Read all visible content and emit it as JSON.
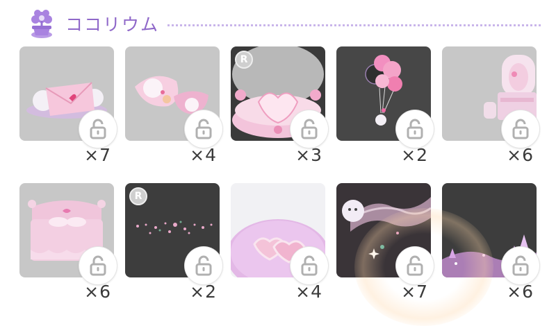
{
  "header": {
    "title": "ココリウム",
    "icon": "kokorium-plant-icon"
  },
  "items": [
    {
      "name": "envelope-ghosts",
      "count": "×7",
      "badge": "",
      "locked": true,
      "bg": "#c7c7c7"
    },
    {
      "name": "ghost-pillows",
      "count": "×4",
      "badge": "",
      "locked": true,
      "bg": "#c7c7c7"
    },
    {
      "name": "heart-cake-stage",
      "count": "×3",
      "badge": "R",
      "locked": true,
      "bg": "#3a3a3a"
    },
    {
      "name": "balloon-ghost",
      "count": "×2",
      "badge": "",
      "locked": true,
      "bg": "#474747"
    },
    {
      "name": "vanity-dresser",
      "count": "×6",
      "badge": "",
      "locked": true,
      "bg": "#c7c7c7"
    },
    {
      "name": "frilly-bed",
      "count": "×6",
      "badge": "",
      "locked": true,
      "bg": "#c7c7c7"
    },
    {
      "name": "sparkle-particles",
      "count": "×2",
      "badge": "R",
      "locked": true,
      "bg": "#3d3d3d"
    },
    {
      "name": "heart-floor-mat",
      "count": "×4",
      "badge": "",
      "locked": true,
      "bg": "#f1f1f4"
    },
    {
      "name": "ghost-smoke-trail",
      "count": "×7",
      "badge": "",
      "locked": true,
      "bg": "#3a3438"
    },
    {
      "name": "crystal-floor",
      "count": "×6",
      "badge": "",
      "locked": true,
      "bg": "#3d3d3d"
    }
  ],
  "colors": {
    "accent": "#8f68c9",
    "dots": "#c9b5ea",
    "lock": "#b0b0b0"
  }
}
